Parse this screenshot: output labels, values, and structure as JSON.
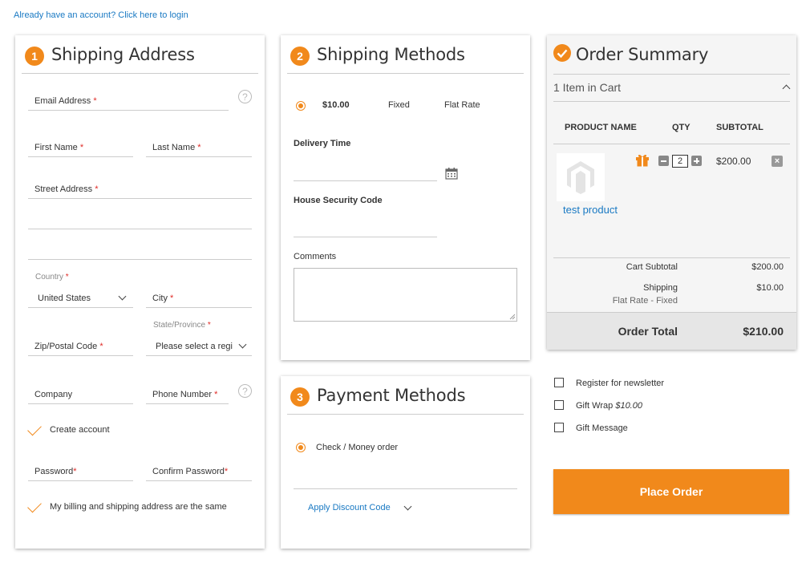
{
  "login_link": "Already have an account? Click here to login",
  "shipping_address": {
    "step": "1",
    "title": "Shipping Address",
    "email_label": "Email Address",
    "first_name_label": "First Name",
    "last_name_label": "Last Name",
    "street_label": "Street Address",
    "country_label": "Country",
    "country_value": "United States",
    "city_label": "City",
    "zip_label": "Zip/Postal Code",
    "state_label": "State/Province",
    "state_value": "Please select a regi",
    "company_label": "Company",
    "phone_label": "Phone Number",
    "create_account_label": "Create account",
    "password_label": "Password",
    "confirm_password_label": "Confirm Password",
    "billing_same_label": "My billing and shipping address are the same",
    "required_mark": "*",
    "help_glyph": "?"
  },
  "shipping_methods": {
    "step": "2",
    "title": "Shipping Methods",
    "price": "$10.00",
    "method": "Fixed",
    "carrier": "Flat Rate",
    "delivery_time_label": "Delivery Time",
    "security_code_label": "House Security Code",
    "comments_label": "Comments"
  },
  "payment_methods": {
    "step": "3",
    "title": "Payment Methods",
    "option_label": "Check / Money order",
    "discount_label": "Apply Discount Code"
  },
  "order_summary": {
    "title": "Order Summary",
    "items_in_cart": "1 Item in Cart",
    "col_product": "PRODUCT NAME",
    "col_qty": "QTY",
    "col_subtotal": "SUBTOTAL",
    "product_name": "test product",
    "qty": "2",
    "product_subtotal": "$200.00",
    "cart_subtotal_label": "Cart Subtotal",
    "cart_subtotal_value": "$200.00",
    "shipping_label": "Shipping",
    "shipping_method": "Flat Rate - Fixed",
    "shipping_value": "$10.00",
    "order_total_label": "Order Total",
    "order_total_value": "$210.00"
  },
  "options": {
    "newsletter_label": "Register for newsletter",
    "gift_wrap_label": "Gift Wrap",
    "gift_wrap_price": "$10.00",
    "gift_message_label": "Gift Message"
  },
  "place_order_label": "Place Order",
  "colors": {
    "accent": "#f1891b",
    "link": "#1979c3",
    "required": "#e02b27"
  }
}
